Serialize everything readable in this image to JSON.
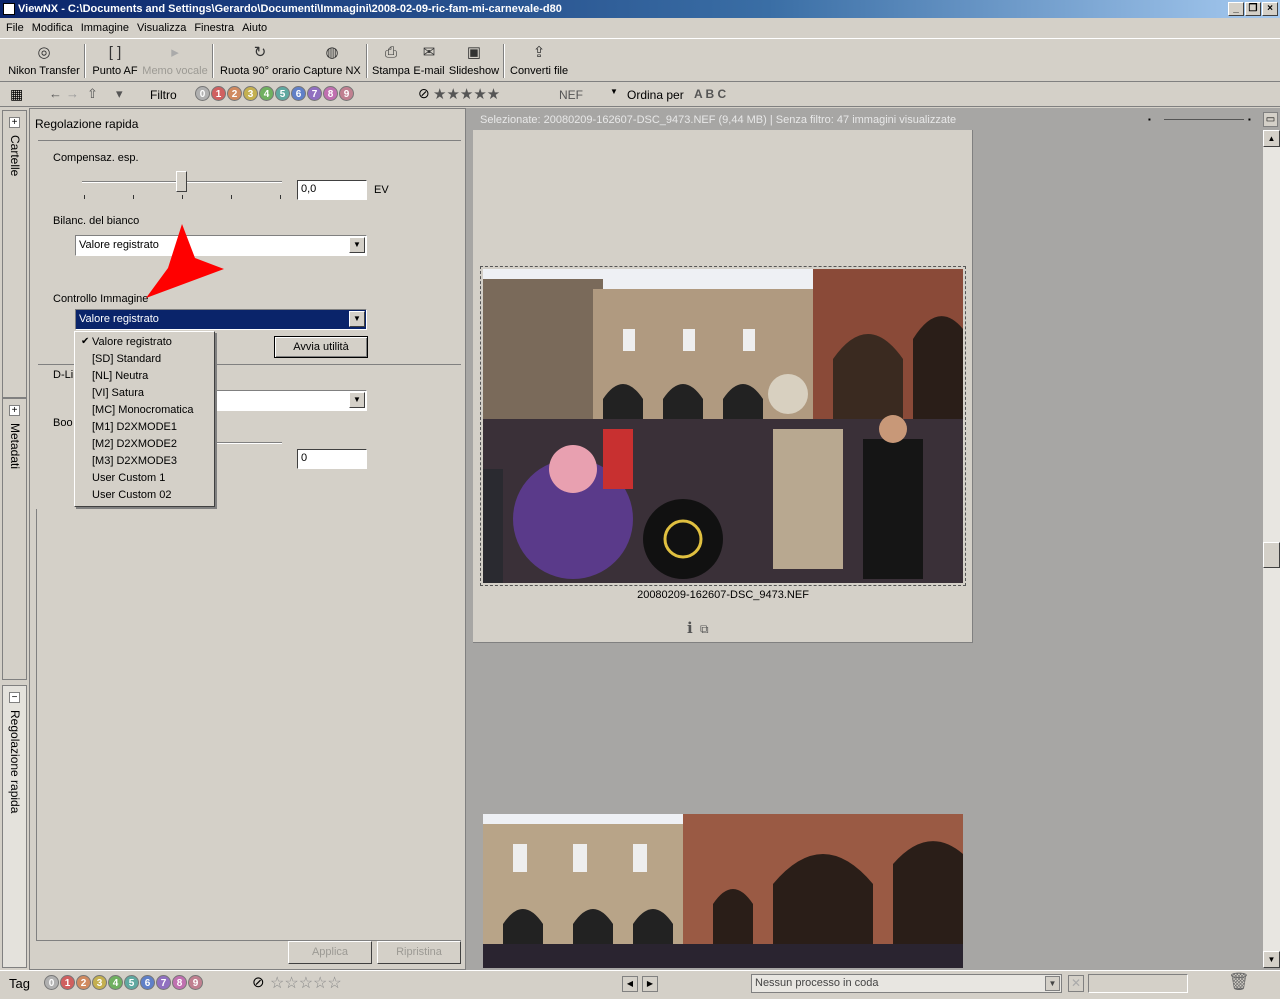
{
  "window": {
    "title": "ViewNX - C:\\Documents and Settings\\Gerardo\\Documenti\\Immagini\\2008-02-09-ric-fam-mi-carnevale-d80"
  },
  "menubar": [
    "File",
    "Modifica",
    "Immagine",
    "Visualizza",
    "Finestra",
    "Aiuto"
  ],
  "toolbar": {
    "nikon_transfer": "Nikon Transfer",
    "punto_af": "Punto AF",
    "memo_vocale": "Memo vocale",
    "ruota": "Ruota 90° orario",
    "capture_nx": "Capture NX",
    "stampa": "Stampa",
    "email": "E-mail",
    "slideshow": "Slideshow",
    "converti": "Converti file"
  },
  "filterbar": {
    "filtro": "Filtro",
    "labels": [
      "0",
      "1",
      "2",
      "3",
      "4",
      "5",
      "6",
      "7",
      "8",
      "9"
    ],
    "label_colors": [
      "#b0b0b0",
      "#d06060",
      "#d08a60",
      "#c4b050",
      "#70b060",
      "#60a8a0",
      "#6080c8",
      "#9070c0",
      "#c070b0",
      "#c08090"
    ],
    "stars": "★★★★★",
    "nef": "NEF",
    "ordina": "Ordina per"
  },
  "sidetabs": {
    "cartelle": "Cartelle",
    "metadati": "Metadati",
    "regolazione": "Regolazione rapida"
  },
  "panel": {
    "title": "Regolazione rapida",
    "comp_label": "Compensaz. esp.",
    "comp_value": "0,0",
    "ev": "EV",
    "wb_label": "Bilanc. del bianco",
    "wb_value": "Valore registrato",
    "ci_label": "Controllo Immagine",
    "ci_value": "Valore registrato",
    "avvia": "Avvia utilità",
    "dl_label": "D-Li",
    "boo_label": "Boo",
    "boost_value": "0",
    "applica": "Applica",
    "ripristina": "Ripristina"
  },
  "dropdown": {
    "items": [
      "Valore registrato",
      "[SD] Standard",
      "[NL] Neutra",
      "[VI] Satura",
      "[MC] Monocromatica",
      "[M1] D2XMODE1",
      "[M2] D2XMODE2",
      "[M3] D2XMODE3",
      "User Custom 1",
      "User Custom 02"
    ],
    "checked": "✔"
  },
  "content": {
    "status": "Selezionate: 20080209-162607-DSC_9473.NEF (9,44 MB) | Senza filtro: 47 immagini visualizzate",
    "filename": "20080209-162607-DSC_9473.NEF"
  },
  "bottombar": {
    "tag": "Tag",
    "queue": "Nessun processo in coda"
  }
}
